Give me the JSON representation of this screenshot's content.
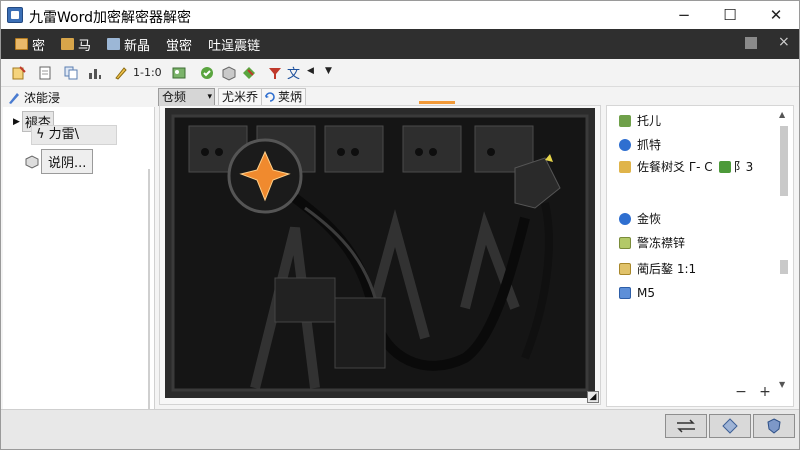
{
  "window": {
    "title": "九雷Word加密解密器解密",
    "minimize": "−",
    "maximize": "☐",
    "close": "✕"
  },
  "menubar": {
    "items": [
      {
        "label": "密",
        "icon": "doc-icon"
      },
      {
        "label": "马",
        "icon": "folder-icon"
      },
      {
        "label": "新晶",
        "icon": "page-icon"
      },
      {
        "label": "蛍密",
        "icon": ""
      },
      {
        "label": "吐逞震链",
        "icon": ""
      }
    ],
    "right_glyph": "×"
  },
  "toolbar": {
    "range_text": "1-1:0"
  },
  "row2": {
    "tab_label": "浓能浸",
    "combo_value": "仓频",
    "segment_a": "尤米乔",
    "segment_b": "荚炳"
  },
  "tree": {
    "root": "褪杏",
    "child1": "力雷\\",
    "child2": "说阴..."
  },
  "properties": {
    "items": [
      {
        "label": "托儿",
        "color": "#6fa04a"
      },
      {
        "label": "抓特",
        "color": "#2f6fd0"
      },
      {
        "label": "佐餐树爻 Г- C",
        "color": "#e0b44a",
        "extra": "阝3",
        "extra_color": "#4d9a3a"
      },
      {
        "label": "金恢",
        "color": "#2f6fd0"
      },
      {
        "label": "警冻襟锌",
        "color": "#b3c968"
      },
      {
        "label": "蔺后鏊 1:1",
        "color": "#e0c26a"
      },
      {
        "label": "M5",
        "color": "#5d8fd8"
      }
    ],
    "zoom_minus": "−",
    "zoom_plus": "+"
  },
  "colors": {
    "menubar": "#2f2f2f",
    "accent_orange": "#f29a38"
  }
}
